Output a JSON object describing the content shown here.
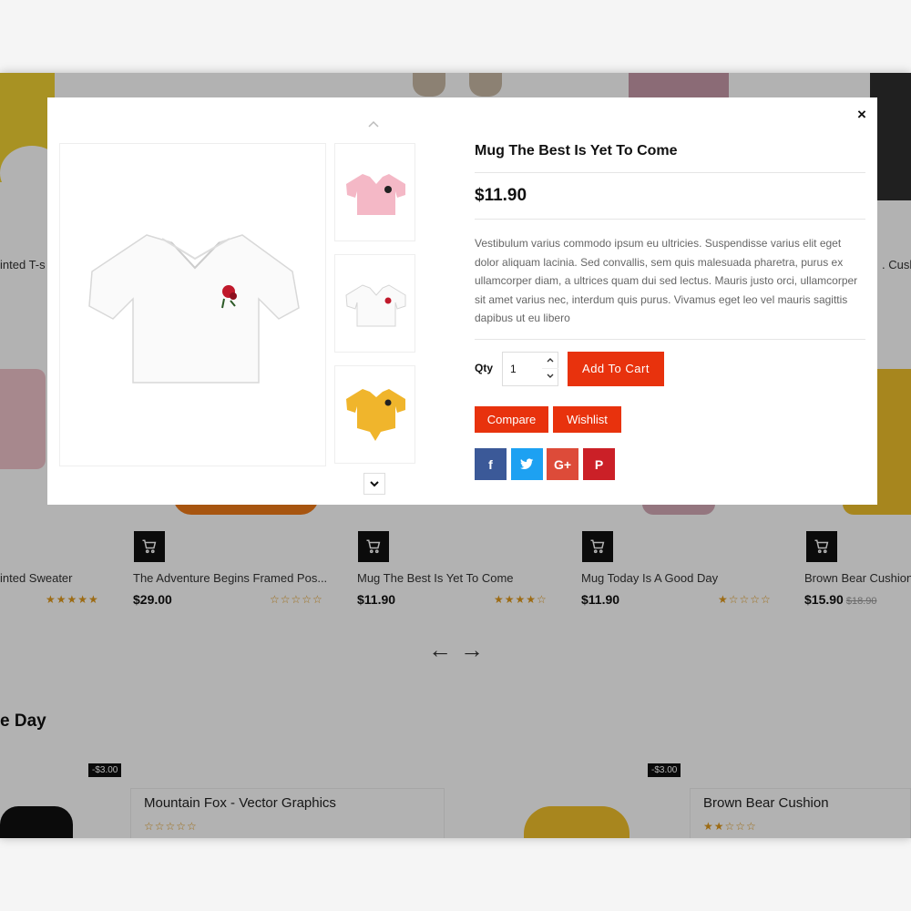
{
  "modal": {
    "title": "Mug The Best Is Yet To Come",
    "price": "$11.90",
    "description": "Vestibulum varius commodo ipsum eu ultricies. Suspendisse varius elit eget dolor aliquam lacinia. Sed convallis, sem quis malesuada pharetra, purus ex ullamcorper diam, a ultrices quam dui sed lectus. Mauris justo orci, ullamcorper sit amet varius nec, interdum quis purus. Vivamus eget leo vel mauris sagittis dapibus ut eu libero",
    "qty_label": "Qty",
    "qty_value": "1",
    "add_to_cart": "Add To Cart",
    "compare": "Compare",
    "wishlist": "Wishlist",
    "close": "×",
    "share": {
      "facebook": "f",
      "twitter": "t",
      "google": "G+",
      "pinterest": "P"
    },
    "thumbnails": [
      "pink crop tee",
      "white crop tee",
      "yellow crop tee"
    ]
  },
  "background": {
    "top_labels": [
      "inted T-s",
      ". Cush"
    ],
    "products": [
      {
        "name": "inted Sweater",
        "price": "",
        "rating": "★★★★★"
      },
      {
        "name": "The Adventure Begins Framed Pos...",
        "price": "$29.00",
        "rating": "☆☆☆☆☆"
      },
      {
        "name": "Mug The Best Is Yet To Come",
        "price": "$11.90",
        "rating": "★★★★☆"
      },
      {
        "name": "Mug Today Is A Good Day",
        "price": "$11.90",
        "rating": "★☆☆☆☆"
      },
      {
        "name": "Brown Bear Cushion",
        "price": "$15.90",
        "old_price": "$18.90",
        "rating": ""
      }
    ],
    "first_rating": "★★★★★",
    "second_rating": "☆☆☆☆☆",
    "arrows": {
      "prev": "←",
      "next": "→"
    },
    "section_title": "e Day",
    "deals": [
      {
        "discount": "-$3.00",
        "name": "Mountain Fox - Vector Graphics",
        "rating": "☆☆☆☆☆"
      },
      {
        "discount": "-$3.00",
        "name": "Brown Bear Cushion",
        "rating": "★★☆☆☆"
      }
    ]
  },
  "colors": {
    "accent": "#e8320d",
    "facebook": "#3b5998",
    "twitter": "#1da1f2",
    "google": "#dd4b39",
    "pinterest": "#cb2027"
  }
}
